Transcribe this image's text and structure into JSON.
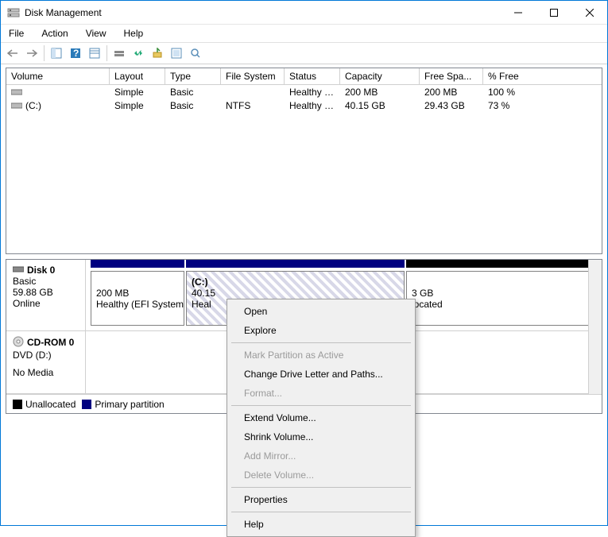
{
  "window": {
    "title": "Disk Management"
  },
  "menu": {
    "file": "File",
    "action": "Action",
    "view": "View",
    "help": "Help"
  },
  "columns": {
    "volume": "Volume",
    "layout": "Layout",
    "type": "Type",
    "fs": "File System",
    "status": "Status",
    "capacity": "Capacity",
    "free": "Free Spa...",
    "pctfree": "% Free"
  },
  "col_widths": {
    "volume": 130,
    "layout": 70,
    "type": 70,
    "fs": 80,
    "status": 70,
    "capacity": 100,
    "free": 80,
    "pctfree": 90
  },
  "volumes": [
    {
      "name": "",
      "layout": "Simple",
      "type": "Basic",
      "fs": "",
      "status": "Healthy (E...",
      "capacity": "200 MB",
      "free": "200 MB",
      "pctfree": "100 %"
    },
    {
      "name": "(C:)",
      "layout": "Simple",
      "type": "Basic",
      "fs": "NTFS",
      "status": "Healthy (B...",
      "capacity": "40.15 GB",
      "free": "29.43 GB",
      "pctfree": "73 %"
    }
  ],
  "disks": {
    "disk0": {
      "name": "Disk 0",
      "type": "Basic",
      "size": "59.88 GB",
      "status": "Online"
    },
    "cdrom": {
      "name": "CD-ROM 0",
      "type": "DVD (D:)",
      "status": "No Media"
    }
  },
  "partitions": {
    "p0": {
      "line1": "200 MB",
      "line2": "Healthy (EFI System P"
    },
    "p1": {
      "name": "(C:)",
      "line1": "40.15",
      "line2": "Heal"
    },
    "p2": {
      "line1": "3 GB",
      "line2": "located"
    }
  },
  "legend": {
    "unallocated": "Unallocated",
    "primary": "Primary partition"
  },
  "context": {
    "open": "Open",
    "explore": "Explore",
    "mark": "Mark Partition as Active",
    "change": "Change Drive Letter and Paths...",
    "format": "Format...",
    "extend": "Extend Volume...",
    "shrink": "Shrink Volume...",
    "mirror": "Add Mirror...",
    "delete": "Delete Volume...",
    "properties": "Properties",
    "help": "Help"
  }
}
